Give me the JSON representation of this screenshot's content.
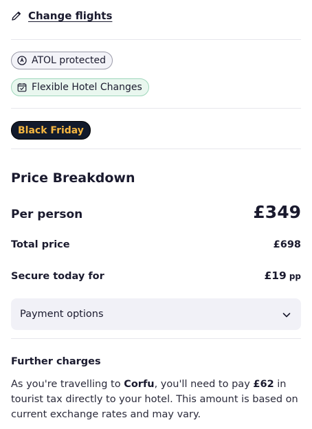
{
  "header": {
    "change_flights_label": "Change flights",
    "icon": "pencil-icon"
  },
  "chips": [
    {
      "label": "ATOL protected",
      "icon": "atol-icon"
    },
    {
      "label": "Flexible Hotel Changes",
      "icon": "calendar-check-icon"
    }
  ],
  "promo": {
    "label": "Black Friday"
  },
  "price": {
    "title": "Price Breakdown",
    "per_person_label": "Per person",
    "per_person_value": "£349",
    "total_label": "Total price",
    "total_value": "£698",
    "secure_label": "Secure today for",
    "secure_value": "£19",
    "secure_suffix": "pp"
  },
  "payment": {
    "label": "Payment options",
    "icon": "chevron-down-icon"
  },
  "further": {
    "title": "Further charges",
    "text_1": "As you're travelling to ",
    "destination": "Corfu",
    "text_2": ", you'll need to pay ",
    "amount": "£62",
    "text_3": " in tourist tax directly to your hotel. This amount is based on current exchange rates and may vary."
  },
  "colors": {
    "text": "#1a1a2e",
    "chip_atol_bg": "#f3f3f8",
    "chip_flex_bg": "#e9f7ef",
    "chip_flex_border": "#9fd7bb",
    "badge_bg": "#121a2b",
    "badge_text": "#f5b640",
    "payment_bg": "#f1f1f7",
    "divider": "#e6e6ec"
  }
}
